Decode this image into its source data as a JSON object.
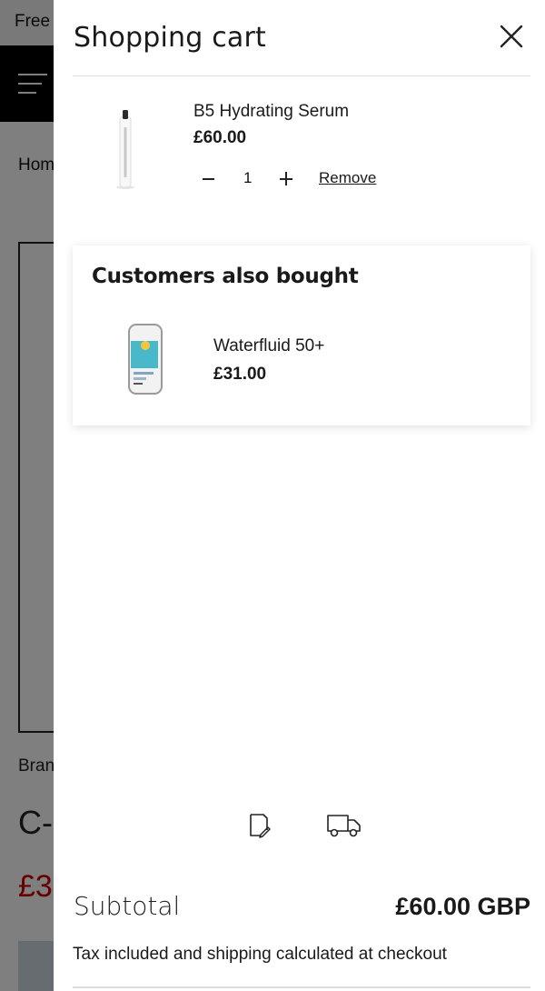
{
  "background_page": {
    "announcement": "Free",
    "breadcrumb": "Hom",
    "brand": "Bran",
    "title": "C-",
    "price": "£3"
  },
  "drawer": {
    "title": "Shopping cart",
    "close_icon": "close-icon",
    "items": [
      {
        "name": "B5 Hydrating Serum",
        "price": "£60.00",
        "quantity": "1",
        "remove_label": "Remove",
        "thumb_icon": "serum-bottle-image"
      }
    ],
    "upsell": {
      "title": "Customers also bought",
      "items": [
        {
          "name": "Waterfluid 50+",
          "price": "£31.00",
          "thumb_icon": "sunscreen-bottle-image"
        }
      ]
    },
    "footer_icons": [
      "note-edit-icon",
      "delivery-truck-icon"
    ],
    "subtotal_label": "Subtotal",
    "subtotal_value": "£60.00 GBP",
    "tax_note": "Tax included and shipping calculated at checkout"
  },
  "colors": {
    "overlay": "#000000",
    "header_bg": "#000000",
    "price_accent": "#cc0000",
    "drawer_bg": "#ffffff"
  }
}
